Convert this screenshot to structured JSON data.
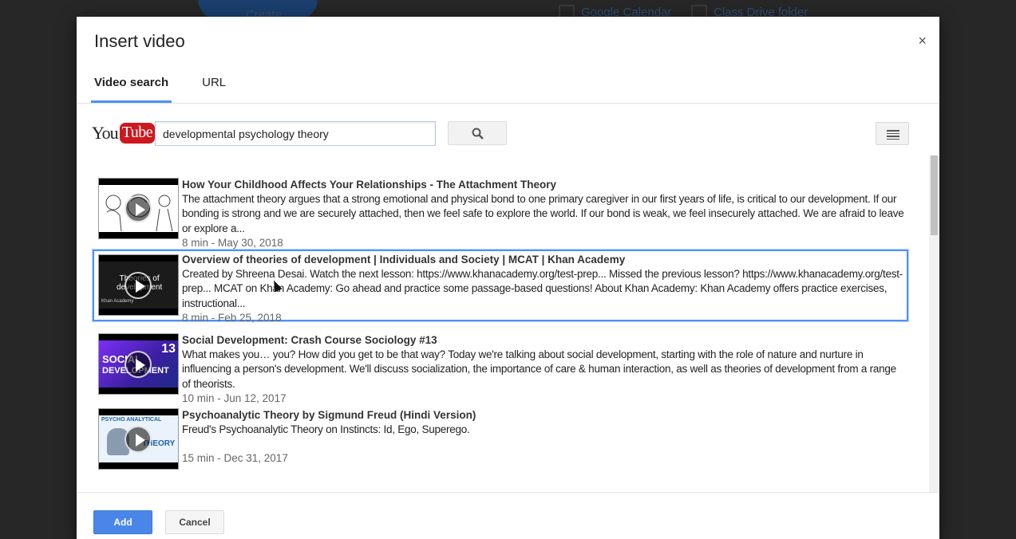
{
  "background": {
    "create_label": "Create",
    "links": [
      "Google Calendar",
      "Class Drive folder"
    ]
  },
  "dialog": {
    "title": "Insert video",
    "close_glyph": "×",
    "tabs": [
      {
        "label": "Video search",
        "active": true
      },
      {
        "label": "URL",
        "active": false
      }
    ],
    "logo": {
      "you": "You",
      "tube": "Tube"
    },
    "search": {
      "value": "developmental psychology theory"
    },
    "results": [
      {
        "title": "How Your Childhood Affects Your Relationships - The Attachment Theory",
        "description": "The attachment theory argues that a strong emotional and physical bond to one primary caregiver in our first years of life, is critical to our development. If our bonding is strong and we are securely attached, then we feel safe to explore the world. If our bond is weak, we feel insecurely attached. We are afraid to leave or explore a...",
        "meta": "8 min - May 30, 2018",
        "selected": false
      },
      {
        "title": "Overview of theories of development | Individuals and Society | MCAT | Khan Academy",
        "description": "Created by Shreena Desai. Watch the next lesson: https://www.khanacademy.org/test-prep... Missed the previous lesson? https://www.khanacademy.org/test-prep... MCAT on Khan Academy: Go ahead and practice some passage-based questions! About Khan Academy: Khan Academy offers practice exercises, instructional...",
        "meta": "8 min - Feb 25, 2018",
        "thumb_text": [
          "Theories of",
          "development",
          "Khan Academy"
        ],
        "selected": true
      },
      {
        "title": "Social Development: Crash Course Sociology #13",
        "description": "What makes you… you? How did you get to be that way? Today we're talking about social development, starting with the role of nature and nurture in influencing a person's development. We'll discuss socialization, the importance of care & human interaction, as well as theories of development from a range of theorists.",
        "meta": "10 min - Jun 12, 2017",
        "thumb_text": [
          "SOCIAL",
          "DEVELOPMENT",
          "13"
        ],
        "selected": false
      },
      {
        "title": "Psychoanalytic Theory by Sigmund Freud (Hindi Version)",
        "description": "Freud's Psychoanalytic Theory on Instincts: Id, Ego, Superego.",
        "meta": "15 min - Dec 31, 2017",
        "thumb_text": [
          "PSYCHO ANALYTICAL",
          "THEORY"
        ],
        "selected": false
      }
    ],
    "footer": {
      "add_label": "Add",
      "cancel_label": "Cancel"
    }
  },
  "colors": {
    "accent": "#4d90fe",
    "add_button": "#4a86e8",
    "youtube_red": "#cc181e"
  }
}
